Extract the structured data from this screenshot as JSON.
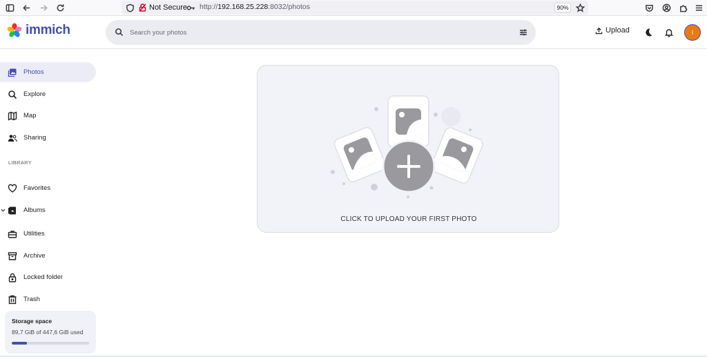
{
  "browser": {
    "security_label": "Not Secure",
    "url_prefix": "http://",
    "url_host": "192.168.25.228",
    "url_rest": ":8032/photos",
    "zoom": "90%"
  },
  "app": {
    "name": "immich",
    "search_placeholder": "Search your photos",
    "upload_label": "Upload",
    "avatar_initial": "I",
    "accent_color": "#4250af",
    "avatar_color": "#e97a14"
  },
  "sidebar": {
    "items": [
      {
        "label": "Photos",
        "icon": "photos-icon",
        "active": true
      },
      {
        "label": "Explore",
        "icon": "search-icon"
      },
      {
        "label": "Map",
        "icon": "map-icon"
      },
      {
        "label": "Sharing",
        "icon": "people-icon"
      }
    ],
    "library_label": "LIBRARY",
    "library_items": [
      {
        "label": "Favorites",
        "icon": "heart-icon"
      },
      {
        "label": "Albums",
        "icon": "album-icon"
      },
      {
        "label": "Utilities",
        "icon": "toolbox-icon"
      },
      {
        "label": "Archive",
        "icon": "archive-icon"
      },
      {
        "label": "Locked folder",
        "icon": "lock-icon"
      },
      {
        "label": "Trash",
        "icon": "trash-icon"
      }
    ],
    "storage": {
      "title": "Storage space",
      "usage": "89,7 GiB of 447,6 GiB used",
      "used_fraction": 0.2
    }
  },
  "main": {
    "empty_message": "CLICK TO UPLOAD YOUR FIRST PHOTO"
  }
}
